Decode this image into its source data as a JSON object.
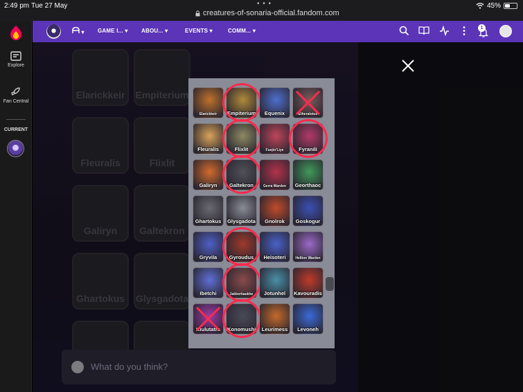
{
  "status_bar": {
    "time": "2:49 pm",
    "date": "Tue 27 May",
    "url": "creatures-of-sonaria-official.fandom.com",
    "battery": "45%",
    "battery_level": 0.45
  },
  "rail": {
    "explore_label": "Explore",
    "fan_central_label": "Fan Central",
    "current_label": "CURRENT"
  },
  "wiki_nav": {
    "items": [
      {
        "label": "GAME I..."
      },
      {
        "label": "ABOU..."
      },
      {
        "label": "EVENTS"
      },
      {
        "label": "COMM..."
      }
    ],
    "notification_count": "1"
  },
  "background_tiles": [
    "Elarickkeir",
    "Empiterium",
    "Fleuralis",
    "Flixlit",
    "Galiryn",
    "Galtekron",
    "Ghartokus",
    "Glysgadota"
  ],
  "comment_placeholder": "What do you think?",
  "image_tiles": [
    {
      "label": "Elarickkeir",
      "circled": false,
      "crossed": false,
      "color": "#c0712a"
    },
    {
      "label": "Empiterium",
      "circled": true,
      "crossed": false,
      "color": "#b08a3a"
    },
    {
      "label": "Equenix",
      "circled": false,
      "crossed": false,
      "color": "#4e6fcf"
    },
    {
      "label": "Etheralotus",
      "circled": false,
      "crossed": true,
      "color": "#7a5a5a"
    },
    {
      "label": "Fleuralis",
      "circled": false,
      "crossed": false,
      "color": "#d9a35a"
    },
    {
      "label": "Flixlit",
      "circled": true,
      "crossed": false,
      "color": "#8d8a62"
    },
    {
      "label": "Fuejin'Liye",
      "circled": false,
      "crossed": false,
      "color": "#c0455a"
    },
    {
      "label": "Fyranili",
      "circled": true,
      "crossed": false,
      "color": "#b23a66"
    },
    {
      "label": "Galiryn",
      "circled": false,
      "crossed": false,
      "color": "#d26a2c"
    },
    {
      "label": "Galtekron",
      "circled": true,
      "crossed": false,
      "color": "#505058"
    },
    {
      "label": "Gerra Warden",
      "circled": false,
      "crossed": false,
      "color": "#b4324a"
    },
    {
      "label": "Georthaoc",
      "circled": false,
      "crossed": false,
      "color": "#3f9a5a"
    },
    {
      "label": "Ghartokus",
      "circled": false,
      "crossed": false,
      "color": "#6a6a72"
    },
    {
      "label": "Glysgadota",
      "circled": false,
      "crossed": false,
      "color": "#8a8c96"
    },
    {
      "label": "Gnolrok",
      "circled": false,
      "crossed": false,
      "color": "#c24a2a"
    },
    {
      "label": "Goskogur",
      "circled": false,
      "crossed": false,
      "color": "#3b4fb5"
    },
    {
      "label": "Gryvila",
      "circled": false,
      "crossed": false,
      "color": "#4f5fc8"
    },
    {
      "label": "Gyroudus",
      "circled": true,
      "crossed": false,
      "color": "#a0392a"
    },
    {
      "label": "Heisoteri",
      "circled": false,
      "crossed": false,
      "color": "#4861c9"
    },
    {
      "label": "Hellion Warden",
      "circled": false,
      "crossed": false,
      "color": "#9b6ac8"
    },
    {
      "label": "Ibetchi",
      "circled": false,
      "crossed": false,
      "color": "#5f6fd8"
    },
    {
      "label": "Jabberkaukhe",
      "circled": true,
      "crossed": false,
      "color": "#8a4a4a"
    },
    {
      "label": "Jotunhel",
      "circled": false,
      "crossed": false,
      "color": "#4a8fa8"
    },
    {
      "label": "Kavouradis",
      "circled": false,
      "crossed": false,
      "color": "#c03a2a"
    },
    {
      "label": "Kiulutatra",
      "circled": false,
      "crossed": true,
      "color": "#9a3aa8"
    },
    {
      "label": "Konomushi",
      "circled": true,
      "crossed": false,
      "color": "#4a4a58"
    },
    {
      "label": "Leurimess",
      "circled": false,
      "crossed": false,
      "color": "#c46a2a"
    },
    {
      "label": "Levoneh",
      "circled": false,
      "crossed": false,
      "color": "#3a6ad8"
    }
  ],
  "colors": {
    "wiki_nav": "#5b34b7",
    "circle": "#ff2a4d"
  }
}
